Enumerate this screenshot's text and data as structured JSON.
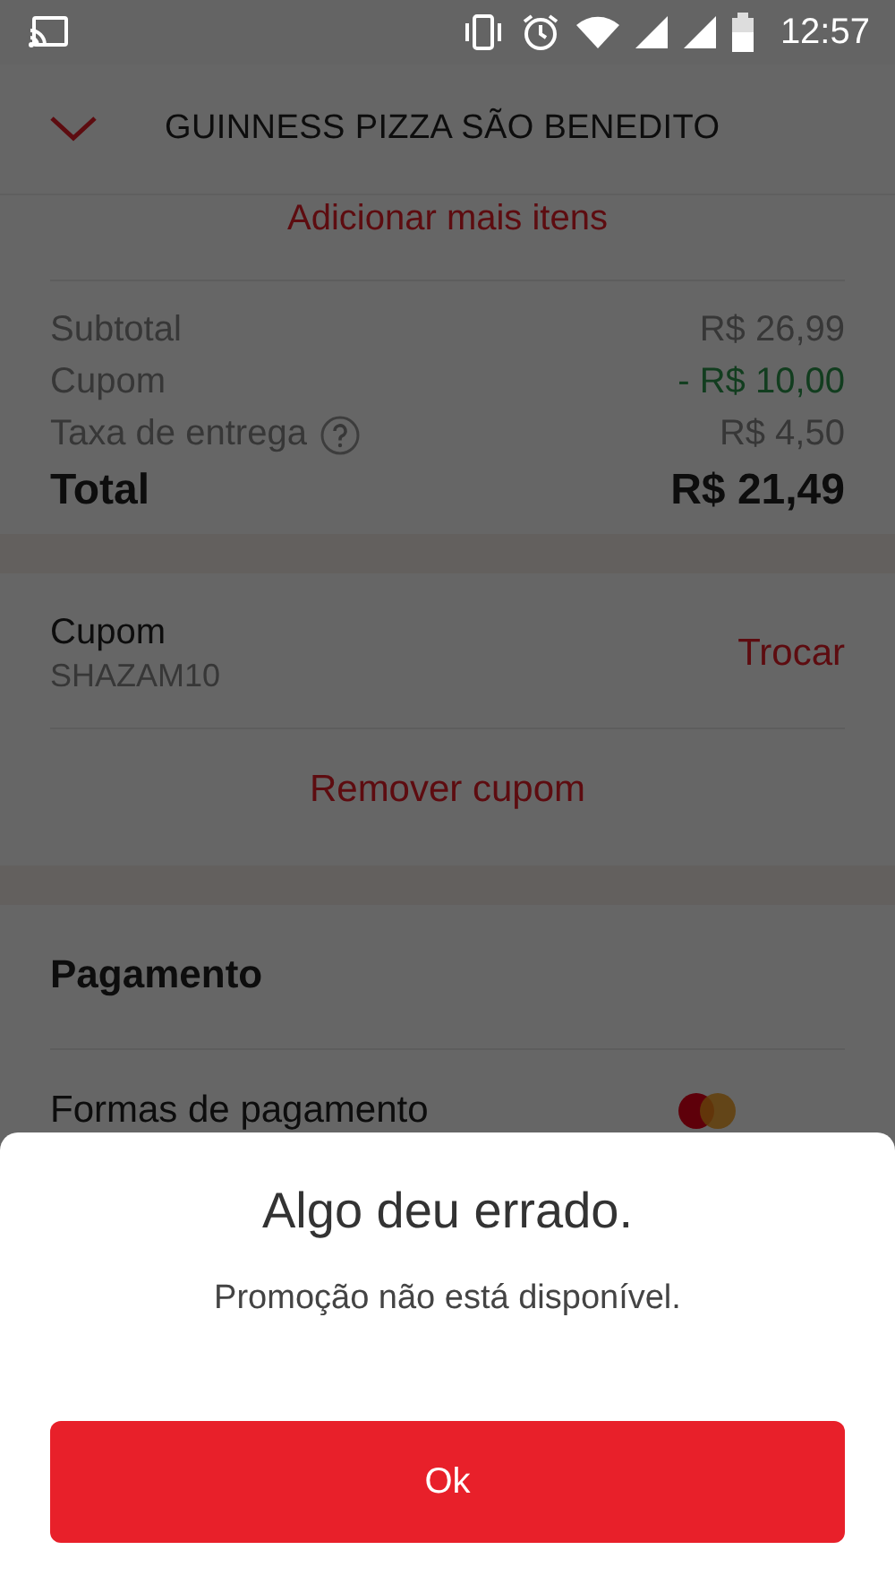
{
  "status_bar": {
    "time": "12:57"
  },
  "header": {
    "title": "GUINNESS PIZZA SÃO BENEDITO"
  },
  "add_items": "Adicionar mais itens",
  "summary": [
    {
      "label": "Subtotal",
      "value": "R$ 26,99",
      "kind": "normal",
      "help": false
    },
    {
      "label": "Cupom",
      "value": "- R$ 10,00",
      "kind": "discount",
      "help": false
    },
    {
      "label": "Taxa de entrega",
      "value": "R$ 4,50",
      "kind": "normal",
      "help": true
    },
    {
      "label": "Total",
      "value": "R$ 21,49",
      "kind": "total",
      "help": false
    }
  ],
  "coupon": {
    "label": "Cupom",
    "code": "SHAZAM10",
    "action": "Trocar",
    "remove": "Remover cupom"
  },
  "payment": {
    "title": "Pagamento",
    "methods_label": "Formas de pagamento"
  },
  "dialog": {
    "title": "Algo deu errado.",
    "message": "Promoção não está disponível.",
    "button": "Ok"
  }
}
